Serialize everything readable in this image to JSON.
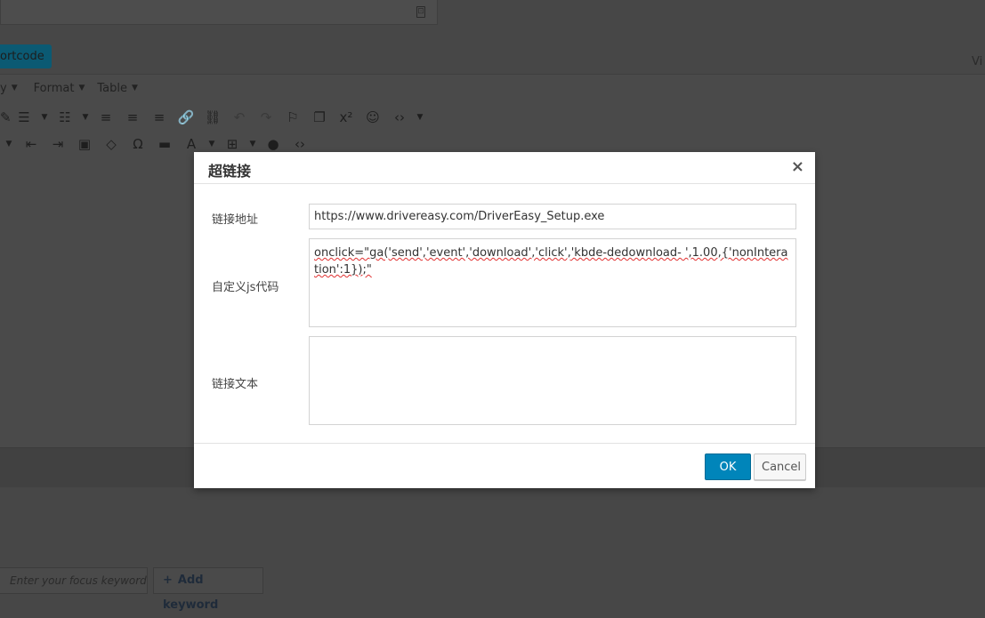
{
  "background": {
    "shortcode_button_label": "ortcode",
    "visual_tab_label": "Vi",
    "menubar": [
      {
        "label": "y"
      },
      {
        "label": "Format"
      },
      {
        "label": "Table"
      }
    ],
    "focus_keyword_placeholder": "Enter your focus keyword",
    "add_keyword_label": "Add keyword"
  },
  "dialog": {
    "title": "超链接",
    "close_glyph": "×",
    "fields": {
      "url_label": "链接地址",
      "url_value": "https://www.drivereasy.com/DriverEasy_Setup.exe",
      "js_label": "自定义js代码",
      "js_value": "onclick=\"ga('send','event','download','click','kbde-dedownload-   ',1.00,{'nonInteration':1});\"",
      "text_label": "链接文本",
      "text_value": ""
    },
    "buttons": {
      "ok": "OK",
      "cancel": "Cancel"
    }
  }
}
